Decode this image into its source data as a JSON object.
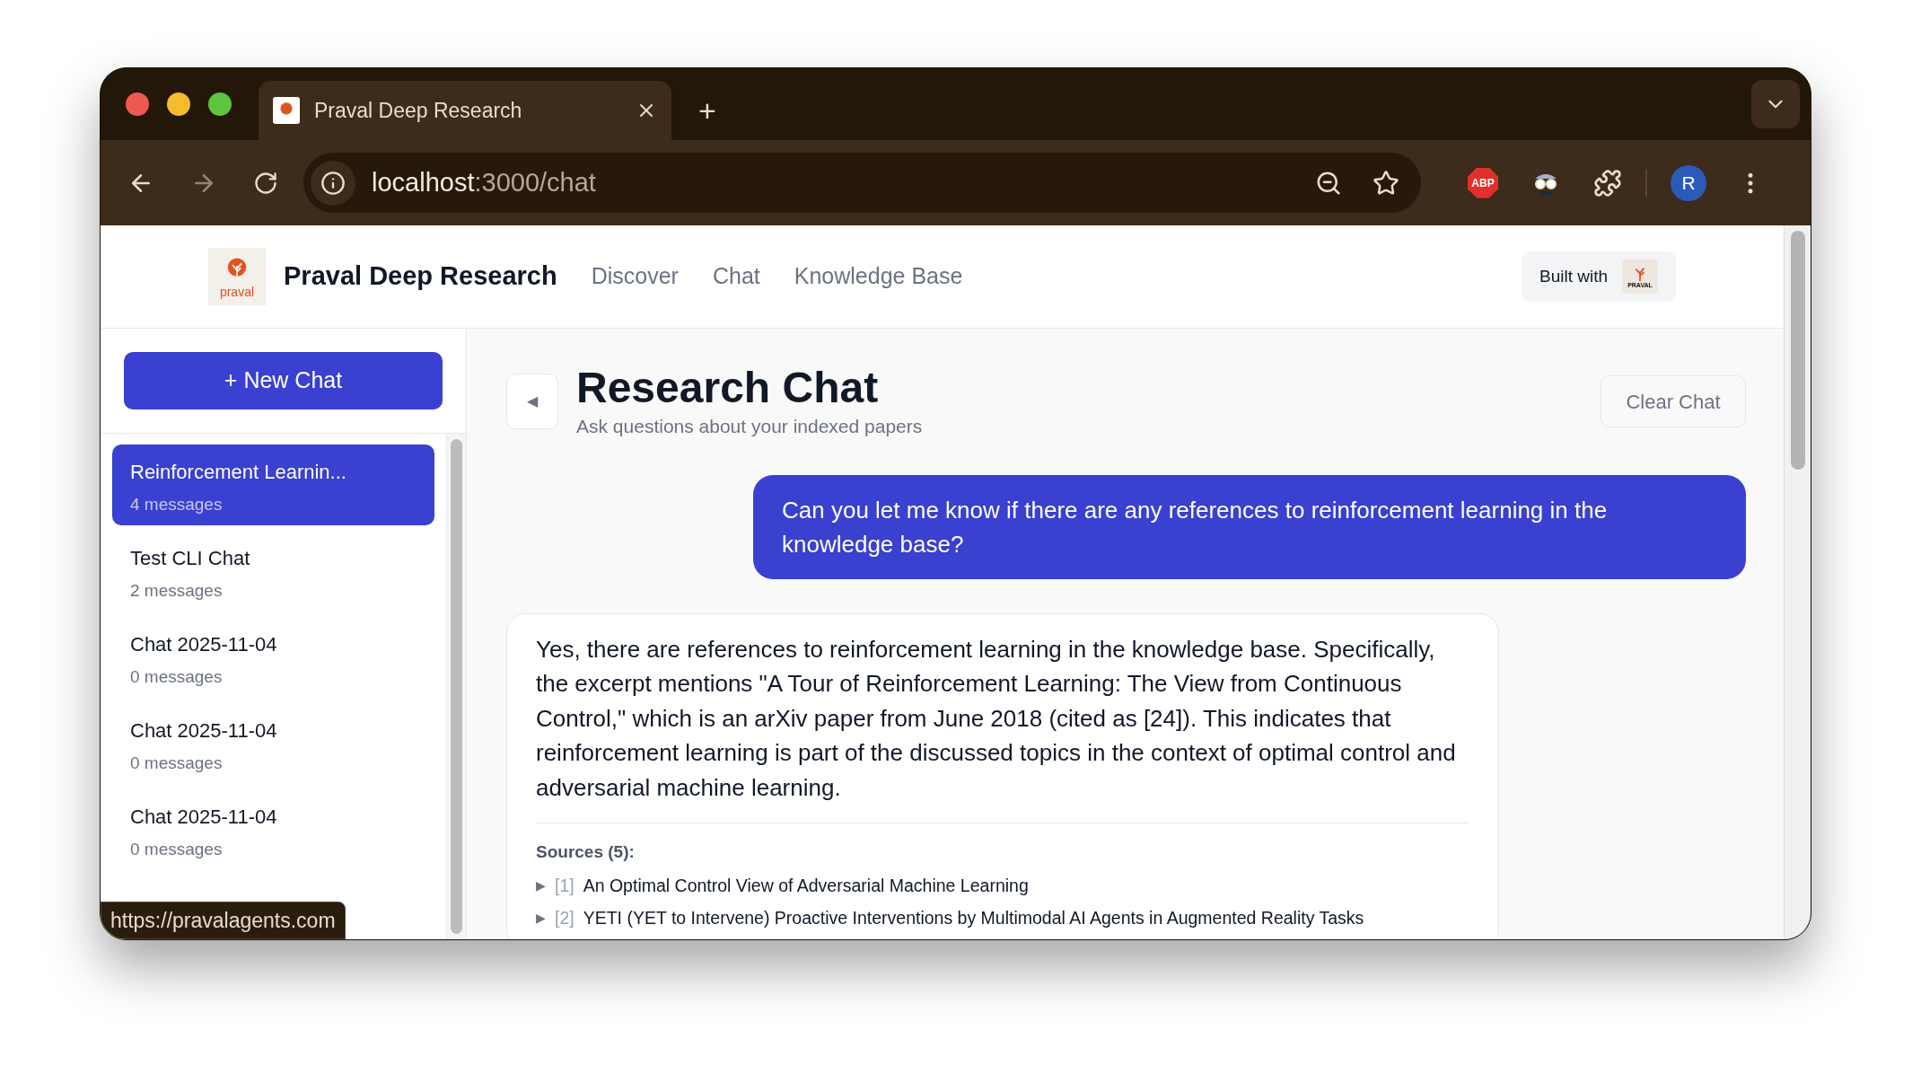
{
  "browser": {
    "tabs": [
      {
        "title": "Praval Deep Research",
        "selected": true
      }
    ],
    "new_tab": "+",
    "address_host": "localhost",
    "address_path": ":3000/chat",
    "extension_label": "ABP",
    "profile_initial": "R",
    "status_url": "https://pravalagents.com"
  },
  "header": {
    "logo_text": "praval",
    "brand": "Praval Deep Research",
    "nav": [
      {
        "label": "Discover"
      },
      {
        "label": "Chat"
      },
      {
        "label": "Knowledge Base"
      }
    ],
    "built_with": "Built with",
    "badge_logo_text": "PRAVAL"
  },
  "sidebar": {
    "new_chat": "+ New Chat",
    "chats": [
      {
        "title": "Reinforcement Learnin...",
        "count": "4 messages",
        "selected": true
      },
      {
        "title": "Test CLI Chat",
        "count": "2 messages",
        "selected": false
      },
      {
        "title": "Chat 2025-11-04",
        "count": "0 messages",
        "selected": false
      },
      {
        "title": "Chat 2025-11-04",
        "count": "0 messages",
        "selected": false
      },
      {
        "title": "Chat 2025-11-04",
        "count": "0 messages",
        "selected": false
      }
    ]
  },
  "main": {
    "back": "◀",
    "title": "Research Chat",
    "subtitle": "Ask questions about your indexed papers",
    "clear": "Clear Chat",
    "messages": [
      {
        "kind": "user",
        "text": "Can you let me know if there are any references to reinforcement learning in the knowledge base?"
      },
      {
        "kind": "assistant",
        "text": "Yes, there are references to reinforcement learning in the knowledge base. Specifically, the excerpt mentions \"A Tour of Reinforcement Learning: The View from Continuous Control,\" which is an arXiv paper from June 2018 (cited as [24]). This indicates that reinforcement learning is part of the discussed topics in the context of optimal control and adversarial machine learning.",
        "sources_label": "Sources (5):",
        "sources": [
          {
            "arrow": "▶",
            "index": "[1]",
            "title": "An Optimal Control View of Adversarial Machine Learning"
          },
          {
            "arrow": "▶",
            "index": "[2]",
            "title": "YETI (YET to Intervene) Proactive Interventions by Multimodal AI Agents in Augmented Reality Tasks"
          }
        ]
      }
    ]
  }
}
